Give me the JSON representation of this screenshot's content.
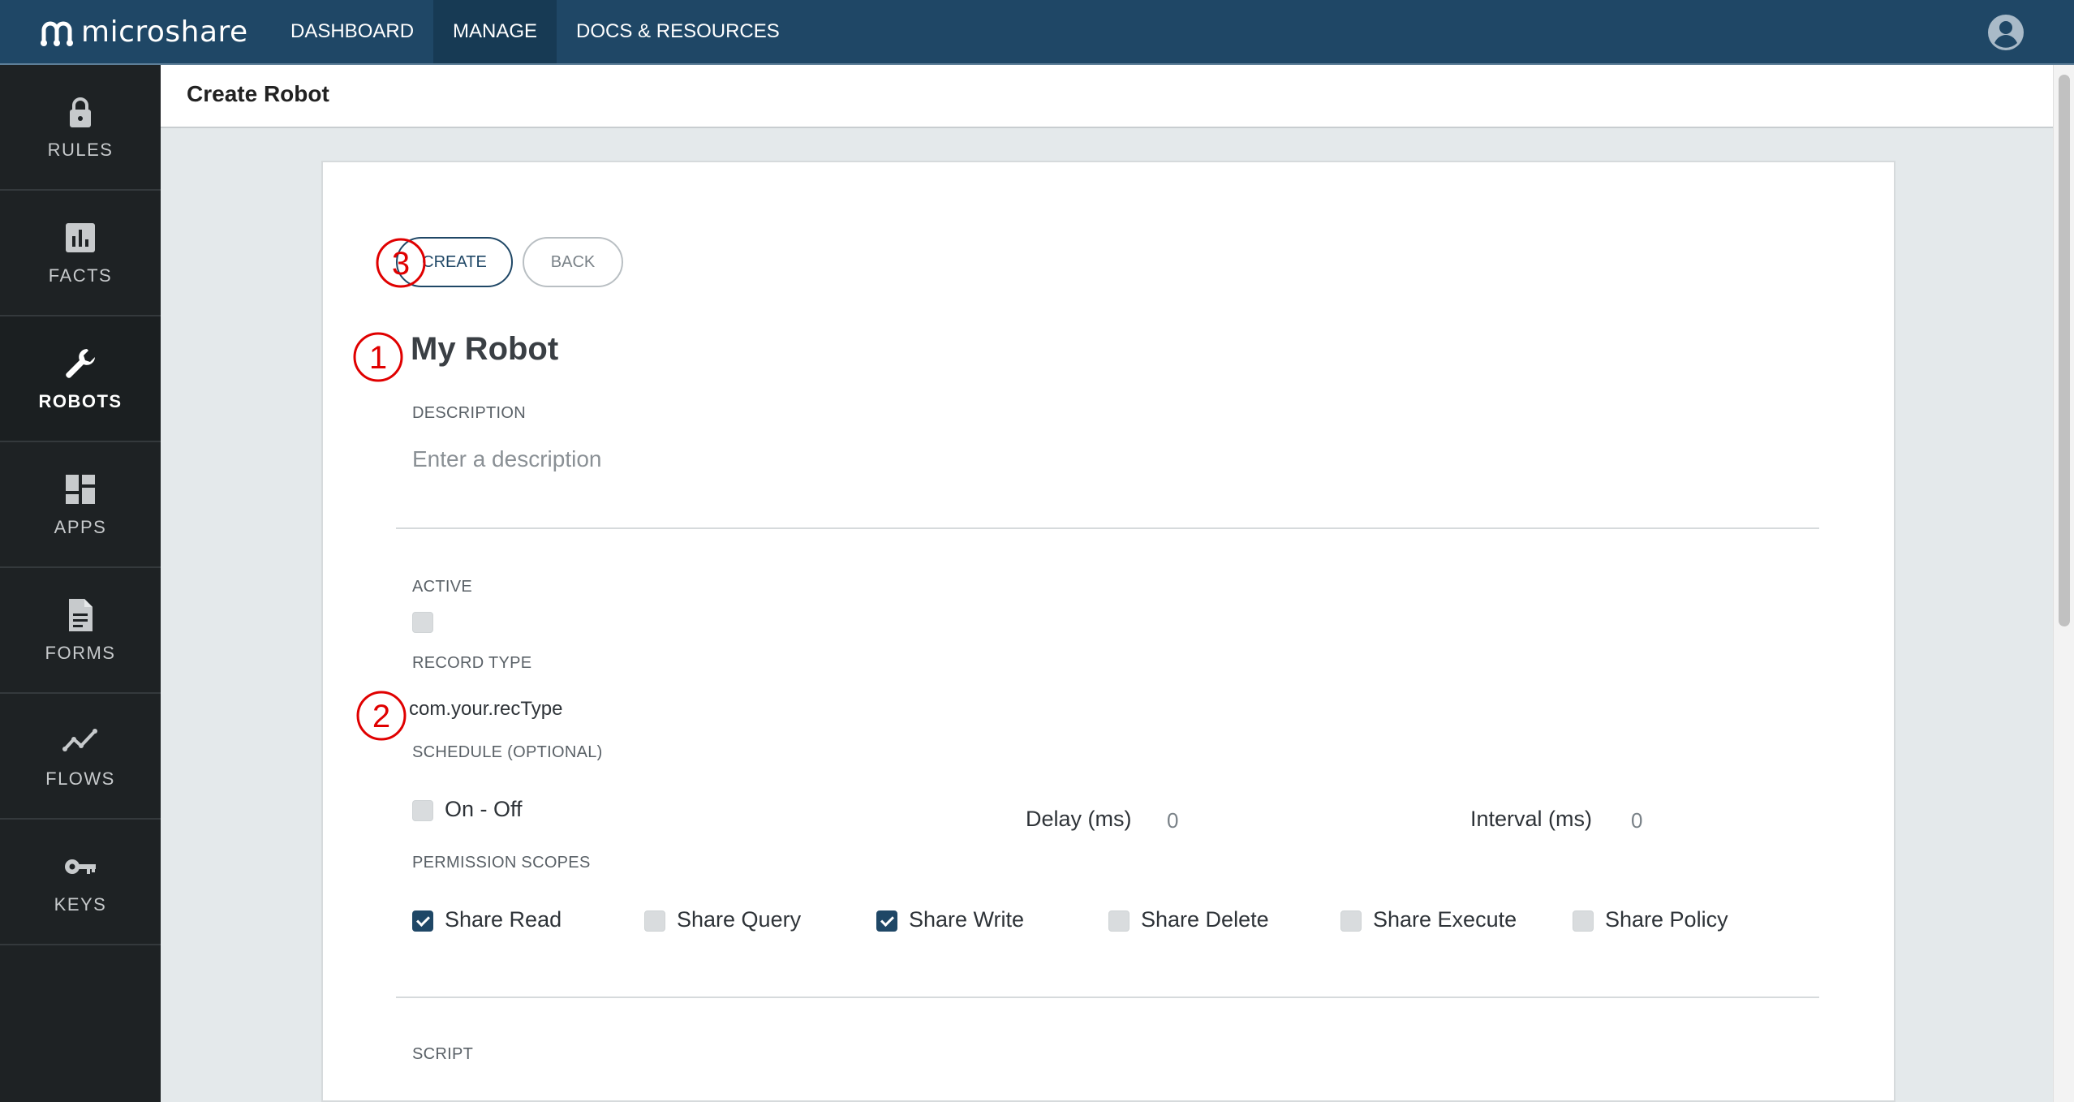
{
  "brand": {
    "name": "microshare"
  },
  "nav": {
    "items": [
      {
        "label": "DASHBOARD"
      },
      {
        "label": "MANAGE"
      },
      {
        "label": "DOCS & RESOURCES"
      }
    ]
  },
  "sidebar": {
    "items": [
      {
        "label": "RULES",
        "icon": "lock-icon"
      },
      {
        "label": "FACTS",
        "icon": "bar-chart-icon"
      },
      {
        "label": "ROBOTS",
        "icon": "wrench-icon"
      },
      {
        "label": "APPS",
        "icon": "dashboard-icon"
      },
      {
        "label": "FORMS",
        "icon": "document-icon"
      },
      {
        "label": "FLOWS",
        "icon": "line-chart-icon"
      },
      {
        "label": "KEYS",
        "icon": "key-icon"
      }
    ]
  },
  "page": {
    "title": "Create Robot"
  },
  "form": {
    "create_label": "CREATE",
    "back_label": "BACK",
    "robot_name": "My Robot",
    "description_label": "DESCRIPTION",
    "description_placeholder": "Enter a description",
    "active_label": "ACTIVE",
    "active_checked": false,
    "record_type_label": "RECORD TYPE",
    "record_type_value": "com.your.recType",
    "schedule_label": "SCHEDULE (OPTIONAL)",
    "schedule_toggle_label": "On - Off",
    "schedule_checked": false,
    "delay_label": "Delay (ms)",
    "delay_value": "0",
    "interval_label": "Interval (ms)",
    "interval_value": "0",
    "permission_label": "PERMISSION SCOPES",
    "permissions": [
      {
        "label": "Share Read",
        "checked": true
      },
      {
        "label": "Share Query",
        "checked": false
      },
      {
        "label": "Share Write",
        "checked": true
      },
      {
        "label": "Share Delete",
        "checked": false
      },
      {
        "label": "Share Execute",
        "checked": false
      },
      {
        "label": "Share Policy",
        "checked": false
      }
    ],
    "script_label": "SCRIPT"
  },
  "annotations": [
    {
      "number": "1"
    },
    {
      "number": "2"
    },
    {
      "number": "3"
    }
  ],
  "colors": {
    "topbar": "#1f4766",
    "sidebar": "#1e2224",
    "accent": "#1f4766",
    "annotation": "#e00000"
  }
}
